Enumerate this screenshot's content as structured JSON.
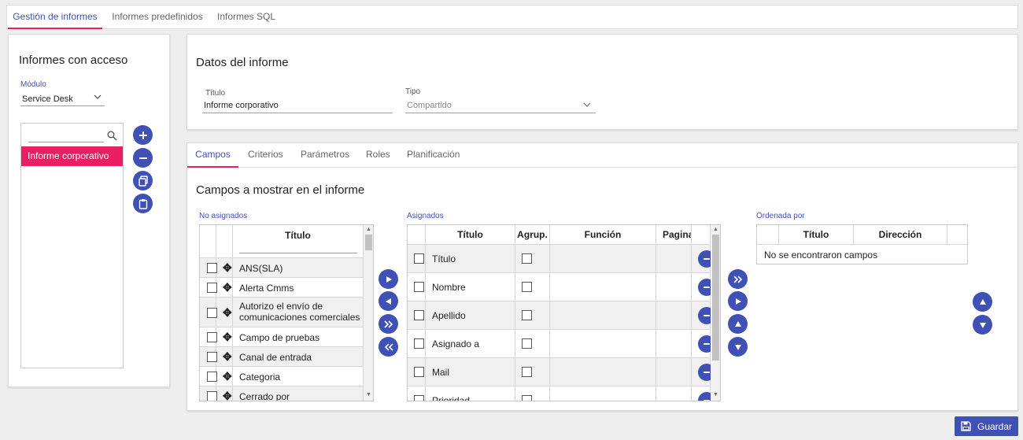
{
  "top_tabs": [
    "Gestión de informes",
    "Informes predefinidos",
    "Informes SQL"
  ],
  "left": {
    "title": "Informes con acceso",
    "module_label": "Módulo",
    "module_value": "Service Desk",
    "search_placeholder": "",
    "list": [
      "Informe corporativo"
    ]
  },
  "details": {
    "title": "Datos del informe",
    "titulo_label": "Título",
    "titulo_value": "Informe corporativo",
    "tipo_label": "Tipo",
    "tipo_value": "Compartido"
  },
  "sub_tabs": [
    "Campos",
    "Criterios",
    "Parámetros",
    "Roles",
    "Planificación"
  ],
  "campos": {
    "heading": "Campos a mostrar en el informe",
    "unassigned": {
      "label": "No asignados",
      "header": "Título",
      "rows": [
        "ANS(SLA)",
        "Alerta Cmms",
        "Autorizo el envío de comunicaciones comerciales",
        "Campo de pruebas",
        "Canal de entrada",
        "Categoria",
        "Cerrado por"
      ]
    },
    "assigned": {
      "label": "Asignados",
      "headers": [
        "Título",
        "Agrup.",
        "Función",
        "Paginar"
      ],
      "rows": [
        "Título",
        "Nombre",
        "Apellido",
        "Asignado a",
        "Mail",
        "Prioridad"
      ]
    },
    "ordered": {
      "label": "Ordenada por",
      "headers": [
        "Título",
        "Dirección"
      ],
      "empty": "No se encontraron campos"
    }
  },
  "save_label": "Guardar",
  "colors": {
    "primary": "#3f51b5",
    "accent": "#e91e63"
  }
}
